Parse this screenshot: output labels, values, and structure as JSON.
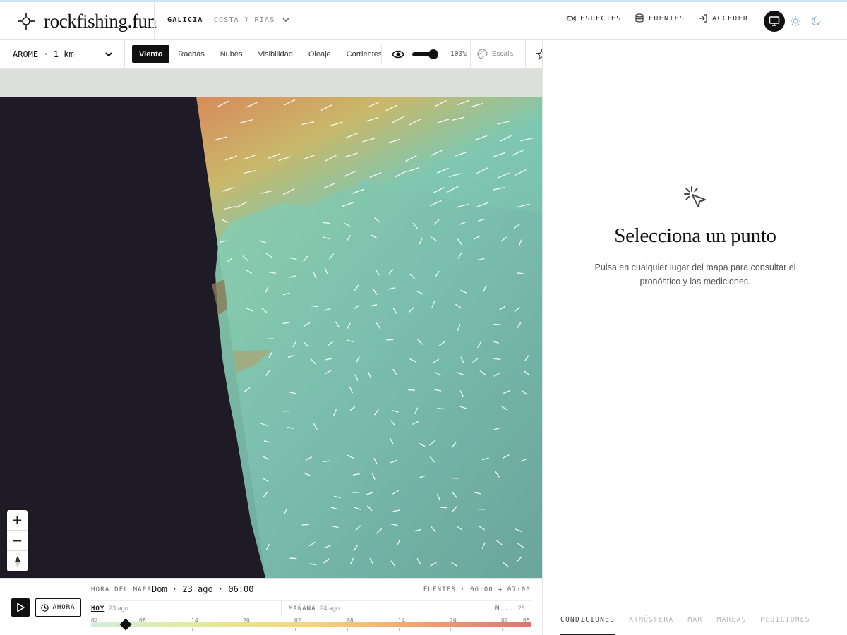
{
  "app": {
    "logo_text": "rockfishing.fun",
    "region_name": "GALICIA",
    "region_separator": "·",
    "region_sub": "COSTA Y RÍAS"
  },
  "nav": {
    "species": "ESPECIES",
    "sources": "FUENTES",
    "login": "ACCEDER"
  },
  "theme": {
    "options": [
      "system-icon",
      "sun-icon",
      "moon-icon"
    ],
    "selected": "system"
  },
  "toolbar": {
    "model": "AROME · 1 km",
    "layers": [
      "Viento",
      "Rachas",
      "Nubes",
      "Visibilidad",
      "Oleaje",
      "Corrientes"
    ],
    "active_layer": "Viento",
    "opacity_value": "100%",
    "opacity_fraction": 1.0,
    "scale_label": "Escala"
  },
  "map": {
    "colors": {
      "ocean_background": "#1e1a26",
      "land_unloaded": "#dde0dd",
      "wind_low": "#7fc7b0",
      "wind_mid": "#c9b86a",
      "wind_high": "#d88a5a"
    }
  },
  "timeline": {
    "play_icon": "play-icon",
    "now_label": "AHORA",
    "map_time_label": "HORA DEL MAPA",
    "map_time_value": "Dom · 23 ago · 06:00",
    "sources_range": "FUENTES · 06:00 → 07:00",
    "days": [
      {
        "name": "HOY",
        "date": "23 ago",
        "active": true
      },
      {
        "name": "MAÑANA",
        "date": "24 ago",
        "active": false
      },
      {
        "name": "M...",
        "date": "25 ...",
        "active": false
      }
    ],
    "hours": [
      "02",
      "08",
      "14",
      "20",
      "02",
      "08",
      "14",
      "20",
      "02",
      "05"
    ],
    "current_position_fraction": 0.078,
    "heat_colors": [
      "#d6ecdc",
      "#e2ea9a",
      "#f3d77a",
      "#f0a272",
      "#e07373"
    ]
  },
  "panel": {
    "title": "Selecciona un punto",
    "description": "Pulsa en cualquier lugar del mapa para consultar el pronóstico y las mediciones.",
    "tabs": [
      "CONDICIONES",
      "ATMÓSFERA",
      "MAR",
      "MAREAS",
      "MEDICIONES"
    ],
    "active_tab": "CONDICIONES"
  }
}
